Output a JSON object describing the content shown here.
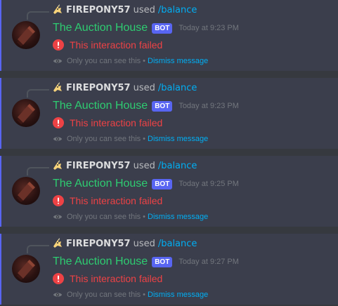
{
  "messages": [
    {
      "reply_user": "FIREPONY57",
      "reply_used": "used",
      "reply_command": "/balance",
      "author": "The Auction House",
      "bot_tag": "BOT",
      "timestamp": "Today at 9:23 PM",
      "error": "This interaction failed",
      "ephemeral_note": "Only you can see this",
      "separator": "•",
      "dismiss": "Dismiss message"
    },
    {
      "reply_user": "FIREPONY57",
      "reply_used": "used",
      "reply_command": "/balance",
      "author": "The Auction House",
      "bot_tag": "BOT",
      "timestamp": "Today at 9:23 PM",
      "error": "This interaction failed",
      "ephemeral_note": "Only you can see this",
      "separator": "•",
      "dismiss": "Dismiss message"
    },
    {
      "reply_user": "FIREPONY57",
      "reply_used": "used",
      "reply_command": "/balance",
      "author": "The Auction House",
      "bot_tag": "BOT",
      "timestamp": "Today at 9:25 PM",
      "error": "This interaction failed",
      "ephemeral_note": "Only you can see this",
      "separator": "•",
      "dismiss": "Dismiss message"
    },
    {
      "reply_user": "FIREPONY57",
      "reply_used": "used",
      "reply_command": "/balance",
      "author": "The Auction House",
      "bot_tag": "BOT",
      "timestamp": "Today at 9:27 PM",
      "error": "This interaction failed",
      "ephemeral_note": "Only you can see this",
      "separator": "•",
      "dismiss": "Dismiss message"
    }
  ],
  "colors": {
    "background": "#36393f",
    "message_highlight": "#3b3e4c",
    "accent_bar": "#5865f2",
    "author_name": "#2ecc71",
    "bot_tag": "#5865f2",
    "error": "#ed4245",
    "link": "#00aff4",
    "muted": "#72767d"
  },
  "icons": {
    "reply_avatar": "unicorn-avatar-icon",
    "error": "exclamation-circle-icon",
    "ephemeral": "eye-icon"
  }
}
